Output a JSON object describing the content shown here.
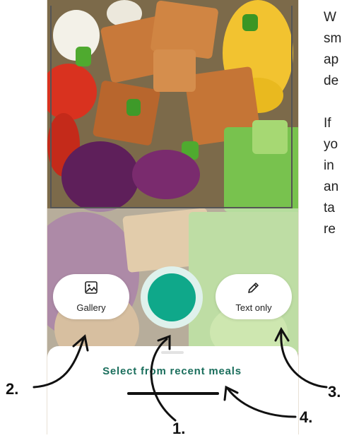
{
  "camera": {
    "gallery_label": "Gallery",
    "text_only_label": "Text only",
    "recent_meals_label": "Select from recent meals"
  },
  "side_text": {
    "lines": [
      "W",
      "sm",
      "ap",
      "de",
      "",
      "If",
      "yo",
      "in",
      "an",
      "ta",
      "re"
    ]
  },
  "annotations": {
    "n1": "1.",
    "n2": "2.",
    "n3": "3.",
    "n4": "4."
  },
  "colors": {
    "accent": "#0fa88a",
    "accent_ring": "#dff1ec",
    "recent_text": "#1a6e5c"
  }
}
